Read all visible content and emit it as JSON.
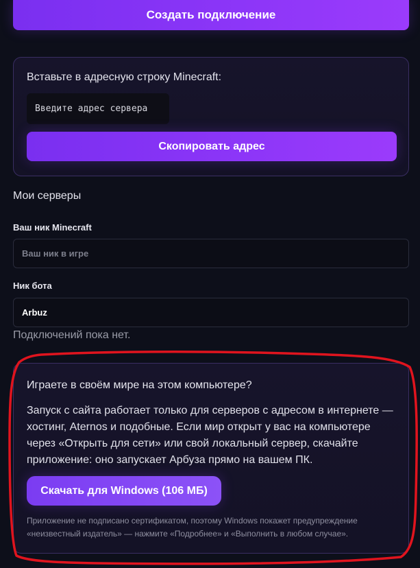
{
  "top": {
    "create_connection_label": "Создать подключение"
  },
  "address_card": {
    "instruction": "Вставьте в адресную строку Minecraft:",
    "server_address_placeholder": "Введите адрес сервера",
    "copy_button_label": "Скопировать адрес"
  },
  "servers": {
    "title": "Мои серверы",
    "nick_label": "Ваш ник Minecraft",
    "nick_placeholder": "Ваш ник в игре",
    "nick_value": "",
    "bot_label": "Ник бота",
    "bot_value": "Arbuz",
    "empty_text": "Подключений пока нет."
  },
  "local_card": {
    "heading": "Играете в своём мире на этом компьютере?",
    "body": "Запуск с сайта работает только для серверов с адресом в интернете — хостинг, Aternos и подобные. Если мир открыт у вас на компьютере через «Открыть для сети» или свой локальный сервер, скачайте приложение: оно запускает Арбуза прямо на вашем ПК.",
    "download_label": "Скачать для Windows (106 МБ)",
    "note": "Приложение не подписано сертификатом, поэтому Windows покажет предупреждение «неизвестный издатель» — нажмите «Подробнее» и «Выполнить в любом случае»."
  },
  "colors": {
    "background": "#0d0f1a",
    "accent": "#8d36f8",
    "card_border": "#3a2e63",
    "annotation_red": "#e0141e"
  }
}
